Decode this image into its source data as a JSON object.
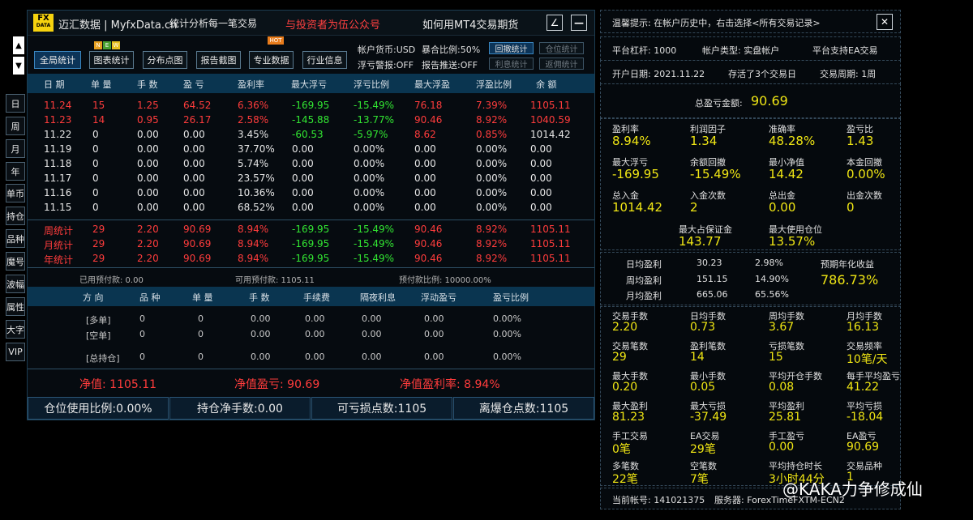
{
  "nav": {
    "up_arrow": "▲",
    "down_arrow": "▼",
    "items": [
      "日",
      "周",
      "月",
      "年",
      "单币",
      "持仓",
      "品种",
      "魔号",
      "波幅",
      "属性",
      "大字",
      "VIP"
    ]
  },
  "header": {
    "logo_top": "FX",
    "logo_bottom": "DATA",
    "brand": "迈汇数据 | MyfxData.cn",
    "slogan": "统计分析每一笔交易",
    "promo": "与投资者为伍公众号",
    "promo2": "如何用MT4交易期货",
    "edit_icon": "∠",
    "min_icon": "—"
  },
  "toolbar": {
    "buttons": [
      "全局统计",
      "图表统计",
      "分布点图",
      "报告截图",
      "专业数据",
      "行业信息"
    ],
    "new_badge": [
      "N",
      "E",
      "W"
    ],
    "hot_badge": "HOT",
    "account_currency": "帐户货币:USD",
    "floating_warning": "浮亏警报:OFF",
    "exposure_ratio": "暴合比例:50%",
    "report_push": "报告推送:OFF",
    "side_buttons": [
      "回撤统计",
      "仓位统计",
      "利息统计",
      "返佣统计"
    ]
  },
  "table": {
    "headers": [
      "日 期",
      "单 量",
      "手 数",
      "盈 亏",
      "盈利率",
      "最大浮亏",
      "浮亏比例",
      "最大浮盈",
      "浮盈比例",
      "余 额"
    ],
    "rows": [
      {
        "date": "11.24",
        "count": "15",
        "lots": "1.25",
        "pl": "64.52",
        "rate": "6.36%",
        "maxloss": "-169.95",
        "lossr": "-15.49%",
        "maxgain": "76.18",
        "gainr": "7.39%",
        "bal": "1105.11",
        "color": "red"
      },
      {
        "date": "11.23",
        "count": "14",
        "lots": "0.95",
        "pl": "26.17",
        "rate": "2.58%",
        "maxloss": "-145.88",
        "lossr": "-13.77%",
        "maxgain": "90.46",
        "gainr": "8.92%",
        "bal": "1040.59",
        "color": "red"
      },
      {
        "date": "11.22",
        "count": "0",
        "lots": "0.00",
        "pl": "0.00",
        "rate": "3.45%",
        "maxloss": "-60.53",
        "lossr": "-5.97%",
        "maxgain": "8.62",
        "gainr": "0.85%",
        "bal": "1014.42",
        "color": "white"
      },
      {
        "date": "11.19",
        "count": "0",
        "lots": "0.00",
        "pl": "0.00",
        "rate": "37.70%",
        "maxloss": "0.00",
        "lossr": "0.00%",
        "maxgain": "0.00",
        "gainr": "0.00%",
        "bal": "0.00",
        "color": "white"
      },
      {
        "date": "11.18",
        "count": "0",
        "lots": "0.00",
        "pl": "0.00",
        "rate": "5.74%",
        "maxloss": "0.00",
        "lossr": "0.00%",
        "maxgain": "0.00",
        "gainr": "0.00%",
        "bal": "0.00",
        "color": "white"
      },
      {
        "date": "11.17",
        "count": "0",
        "lots": "0.00",
        "pl": "0.00",
        "rate": "23.57%",
        "maxloss": "0.00",
        "lossr": "0.00%",
        "maxgain": "0.00",
        "gainr": "0.00%",
        "bal": "0.00",
        "color": "white"
      },
      {
        "date": "11.16",
        "count": "0",
        "lots": "0.00",
        "pl": "0.00",
        "rate": "10.36%",
        "maxloss": "0.00",
        "lossr": "0.00%",
        "maxgain": "0.00",
        "gainr": "0.00%",
        "bal": "0.00",
        "color": "white"
      },
      {
        "date": "11.15",
        "count": "0",
        "lots": "0.00",
        "pl": "0.00",
        "rate": "68.52%",
        "maxloss": "0.00",
        "lossr": "0.00%",
        "maxgain": "0.00",
        "gainr": "0.00%",
        "bal": "0.00",
        "color": "white"
      }
    ],
    "summary": [
      {
        "date": "周统计",
        "count": "29",
        "lots": "2.20",
        "pl": "90.69",
        "rate": "8.94%",
        "maxloss": "-169.95",
        "lossr": "-15.49%",
        "maxgain": "90.46",
        "gainr": "8.92%",
        "bal": "1105.11"
      },
      {
        "date": "月统计",
        "count": "29",
        "lots": "2.20",
        "pl": "90.69",
        "rate": "8.94%",
        "maxloss": "-169.95",
        "lossr": "-15.49%",
        "maxgain": "90.46",
        "gainr": "8.92%",
        "bal": "1105.11"
      },
      {
        "date": "年统计",
        "count": "29",
        "lots": "2.20",
        "pl": "90.69",
        "rate": "8.94%",
        "maxloss": "-169.95",
        "lossr": "-15.49%",
        "maxgain": "90.46",
        "gainr": "8.92%",
        "bal": "1105.11"
      }
    ]
  },
  "margin": {
    "used": "已用预付款: 0.00",
    "free": "可用预付款: 1105.11",
    "level": "预付款比例: 10000.00%"
  },
  "positions": {
    "headers": [
      "方 向",
      "品 种",
      "单 量",
      "手 数",
      "手续费",
      "隔夜利息",
      "浮动盈亏",
      "盈亏比例"
    ],
    "rows": [
      [
        "[多单]",
        "0",
        "0",
        "0.00",
        "0.00",
        "0.00",
        "0.00",
        "0.00%"
      ],
      [
        "[空单]",
        "0",
        "0",
        "0.00",
        "0.00",
        "0.00",
        "0.00",
        "0.00%"
      ],
      [
        "[总持仓]",
        "0",
        "0",
        "0.00",
        "0.00",
        "0.00",
        "0.00",
        "0.00%"
      ]
    ]
  },
  "netvalue": {
    "net": "净值: 1105.11",
    "net_pl": "净值盈亏: 90.69",
    "net_rate": "净值盈利率: 8.94%"
  },
  "bottom": [
    "仓位使用比例:0.00%",
    "持仓净手数:0.00",
    "可亏损点数:1105",
    "离爆仓点数:1105"
  ],
  "right": {
    "tip": "温馨提示: 在帐户历史中，右击选择<所有交易记录>",
    "close_icon": "✕",
    "leverage": "平台杠杆: 1000",
    "account_type": "帐户类型: 实盘帐户",
    "ea_support": "平台支持EA交易",
    "open_date": "开户日期: 2021.11.22",
    "stored": "存活了3个交易日",
    "period": "交易周期: 1周",
    "total_pl_label": "总盈亏金额:",
    "total_pl_value": "90.69",
    "stats1": [
      {
        "label": "盈利率",
        "value": "8.94%"
      },
      {
        "label": "利润因子",
        "value": "1.34"
      },
      {
        "label": "准确率",
        "value": "48.28%"
      },
      {
        "label": "盈亏比",
        "value": "1.43"
      },
      {
        "label": "最大浮亏",
        "value": "-169.95"
      },
      {
        "label": "余额回撤",
        "value": "-15.49%"
      },
      {
        "label": "最小净值",
        "value": "14.42"
      },
      {
        "label": "本金回撤",
        "value": "0.00%"
      },
      {
        "label": "总入金",
        "value": "1014.42"
      },
      {
        "label": "入金次数",
        "value": "2"
      },
      {
        "label": "总出金",
        "value": "0.00"
      },
      {
        "label": "出金次数",
        "value": "0"
      }
    ],
    "max_margin_label": "最大占保证金",
    "max_margin_value": "143.77",
    "max_pos_label": "最大使用仓位",
    "max_pos_value": "13.57%",
    "daily": {
      "label": "日均盈利",
      "v1": "30.23",
      "v2": "2.98%"
    },
    "weekly": {
      "label": "周均盈利",
      "v1": "151.15",
      "v2": "14.90%"
    },
    "monthly": {
      "label": "月均盈利",
      "v1": "665.06",
      "v2": "65.56%"
    },
    "annual_label": "预期年化收益",
    "annual_value": "786.73%",
    "stats2": [
      {
        "label": "交易手数",
        "value": "2.20"
      },
      {
        "label": "日均手数",
        "value": "0.73"
      },
      {
        "label": "周均手数",
        "value": "3.67"
      },
      {
        "label": "月均手数",
        "value": "16.13"
      },
      {
        "label": "交易笔数",
        "value": "29"
      },
      {
        "label": "盈利笔数",
        "value": "14"
      },
      {
        "label": "亏损笔数",
        "value": "15"
      },
      {
        "label": "交易频率",
        "value": "10笔/天"
      },
      {
        "label": "最大手数",
        "value": "0.20"
      },
      {
        "label": "最小手数",
        "value": "0.05"
      },
      {
        "label": "平均开仓手数",
        "value": "0.08"
      },
      {
        "label": "每手平均盈亏",
        "value": "41.22"
      },
      {
        "label": "最大盈利",
        "value": "81.23"
      },
      {
        "label": "最大亏损",
        "value": "-37.49"
      },
      {
        "label": "平均盈利",
        "value": "25.81"
      },
      {
        "label": "平均亏损",
        "value": "-18.04"
      },
      {
        "label": "手工交易",
        "value": "0笔"
      },
      {
        "label": "EA交易",
        "value": "29笔"
      },
      {
        "label": "手工盈亏",
        "value": "0.00"
      },
      {
        "label": "EA盈亏",
        "value": "90.69"
      },
      {
        "label": "多笔数",
        "value": "22笔"
      },
      {
        "label": "空笔数",
        "value": "7笔"
      },
      {
        "label": "平均持仓时长",
        "value": "3小时44分"
      },
      {
        "label": "交易品种",
        "value": "1"
      }
    ],
    "account_no": "当前帐号: 141021375",
    "server": "服务器: ForexTimeFXTM-ECN2"
  },
  "watermark": "@KAKA力争修成仙",
  "colors": {
    "accent": "#0a3550",
    "red": "#ff3c3c",
    "green": "#32e632",
    "yellow": "#f0e614",
    "promo": "#ff4040"
  }
}
